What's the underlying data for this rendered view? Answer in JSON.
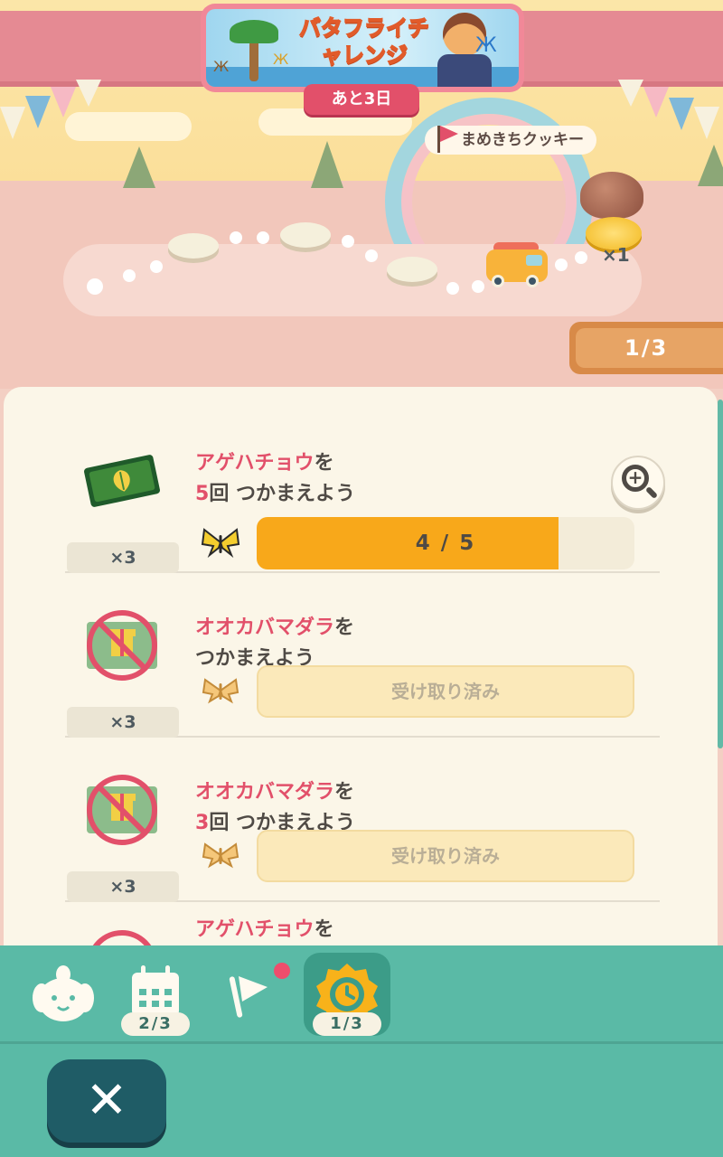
{
  "event": {
    "banner_title": "バタフライチャレンジ",
    "countdown": "あと3日",
    "reward_goal_label": "まめきちクッキー",
    "reward_goal_count": "×1",
    "page_indicator": "1/3"
  },
  "tasks": [
    {
      "title_highlight": "アゲハチョウ",
      "title_rest": "を",
      "line2_highlight": "5",
      "line2_rest": "回 つかまえよう",
      "reward_icon": "leaf-ticket-icon",
      "reward_count": "×3",
      "progress_text": "4 / 5",
      "progress_fraction": 0.8,
      "state": "in_progress"
    },
    {
      "title_highlight": "オオカバマダラ",
      "title_rest": "を",
      "line2_highlight": "",
      "line2_rest": "つかまえよう",
      "reward_icon": "gift-ticket-icon",
      "reward_count": "×3",
      "status_text": "受け取り済み",
      "state": "claimed"
    },
    {
      "title_highlight": "オオカバマダラ",
      "title_rest": "を",
      "line2_highlight": "3",
      "line2_rest": "回 つかまえよう",
      "reward_icon": "gift-ticket-icon",
      "reward_count": "×3",
      "status_text": "受け取り済み",
      "state": "claimed"
    },
    {
      "title_highlight": "アゲハチョウ",
      "title_rest": "を"
    }
  ],
  "nav": {
    "calendar_count": "2/3",
    "timer_count": "1/3"
  },
  "colors": {
    "accent_pink": "#e2506a",
    "progress_orange": "#f8a81a",
    "nav_teal": "#5abaa6",
    "close_button": "#1f5c66"
  }
}
